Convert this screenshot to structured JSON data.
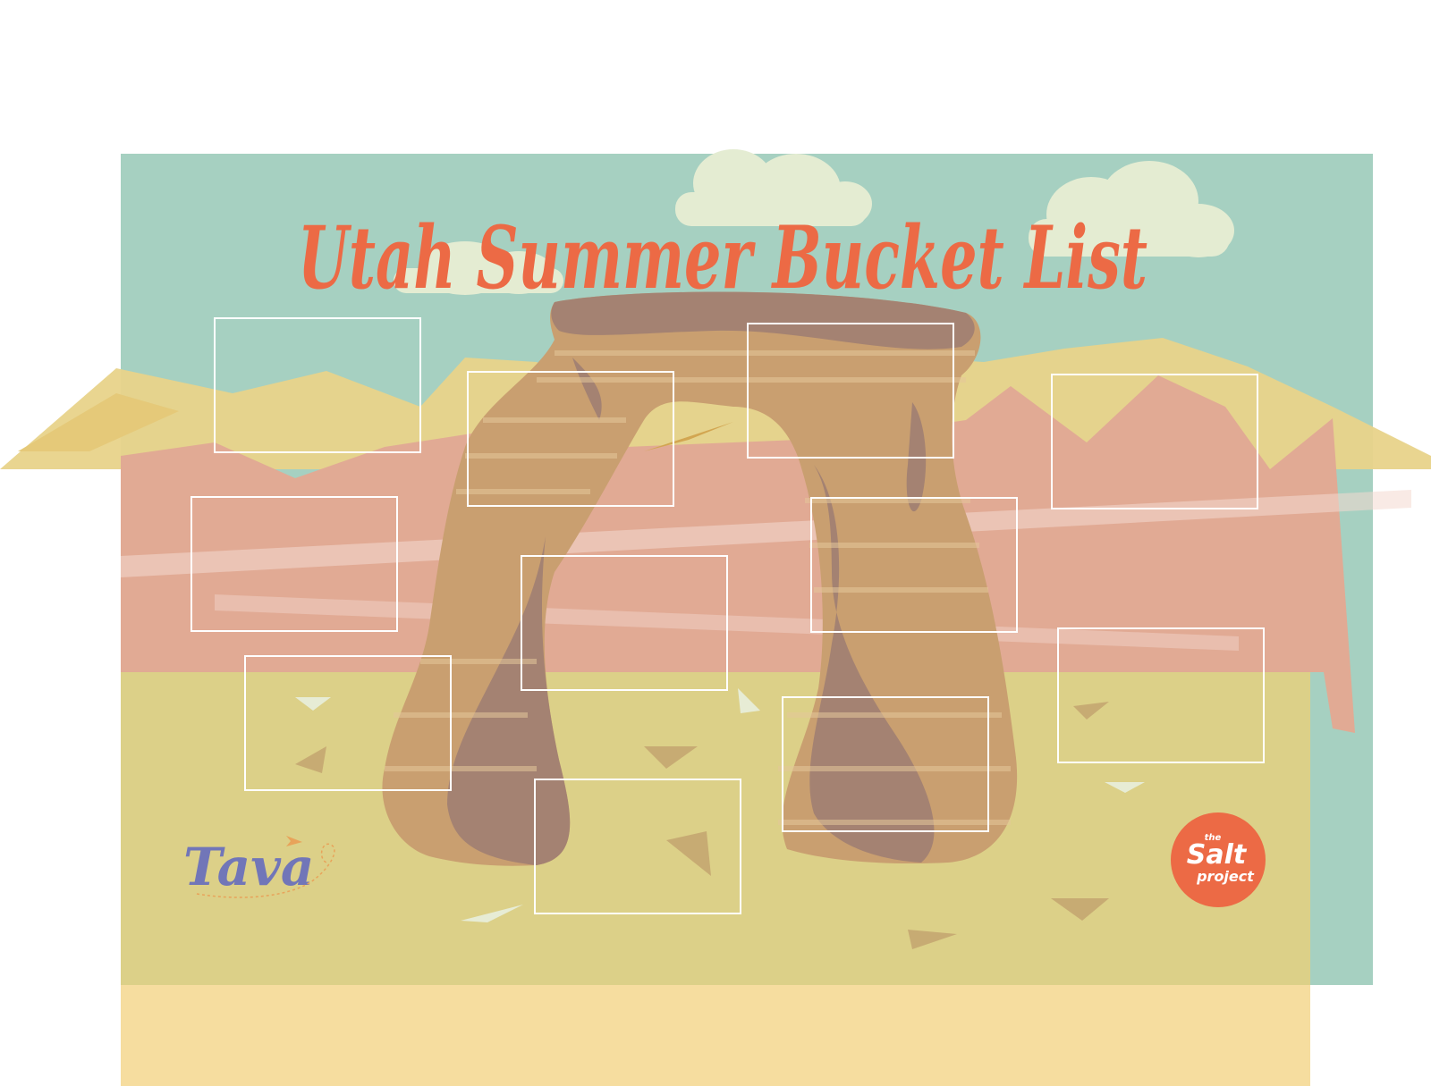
{
  "title": "Utah Summer Bucket List",
  "logos": {
    "tava": "Tava",
    "salt_small": "the",
    "salt_main": "Salt",
    "salt_sub": "project"
  },
  "colors": {
    "sky": "#a6d0c1",
    "mountain_yellow": "#e8d38a",
    "mountain_pink": "#e1aa94",
    "ground": "#dcd088",
    "ground_bottom": "#f6dd9f",
    "arch_tan": "#c99f70",
    "arch_shadow": "#a48272",
    "title": "#ec6a45",
    "tava": "#7176b8",
    "salt_badge": "#ec6a45",
    "cloud": "#e4ecd2"
  },
  "boxes": [
    {
      "label": ""
    },
    {
      "label": ""
    },
    {
      "label": ""
    },
    {
      "label": ""
    },
    {
      "label": ""
    },
    {
      "label": ""
    },
    {
      "label": ""
    },
    {
      "label": ""
    },
    {
      "label": ""
    },
    {
      "label": ""
    },
    {
      "label": ""
    },
    {
      "label": ""
    }
  ]
}
